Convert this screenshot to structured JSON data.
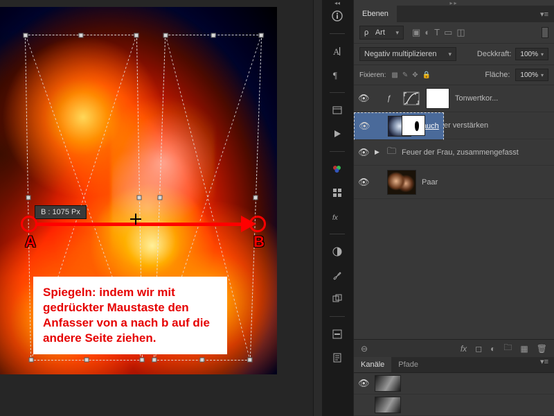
{
  "tooltip": {
    "label": "B : 1075 Px"
  },
  "markers": {
    "a": "A",
    "b": "B"
  },
  "callout": "Spiegeln: indem wir mit gedrückter Maustaste den Anfasser von a nach b auf die andere Seite ziehen.",
  "strip_icons": [
    "info-icon",
    "character-icon",
    "paragraph-icon",
    "history-icon",
    "actions-icon",
    "swatches-icon",
    "color-icon",
    "styles-icon",
    "adjustments-icon",
    "brush-icon",
    "clone-source-icon",
    "measure-icon",
    "notes-icon"
  ],
  "layers_panel": {
    "tab": "Ebenen",
    "filter_label": "Art",
    "filter_icons": [
      "image-filter-icon",
      "adjust-filter-icon",
      "type-filter-icon",
      "shape-filter-icon",
      "smart-filter-icon"
    ],
    "blend_mode": "Negativ multiplizieren",
    "opacity_label": "Deckkraft:",
    "opacity_value": "100%",
    "lock_label": "Fixieren:",
    "fill_label": "Fläche:",
    "fill_value": "100%",
    "layers": [
      {
        "kind": "adjustment",
        "name": "Tonwertkor..."
      },
      {
        "kind": "smoke",
        "name": "Rauch",
        "selected": true,
        "underline": true
      },
      {
        "kind": "group-fire",
        "name": "Feuer verstärken"
      },
      {
        "kind": "group",
        "name": "Feuer der Frau, zusammengefasst"
      },
      {
        "kind": "paar",
        "name": "Paar"
      }
    ],
    "footer_icons": [
      "link-icon",
      "fx-icon",
      "mask-icon",
      "adjustment-icon",
      "group-icon",
      "new-layer-icon",
      "trash-icon"
    ]
  },
  "channels_panel": {
    "tabs": [
      "Kanäle",
      "Pfade"
    ]
  }
}
